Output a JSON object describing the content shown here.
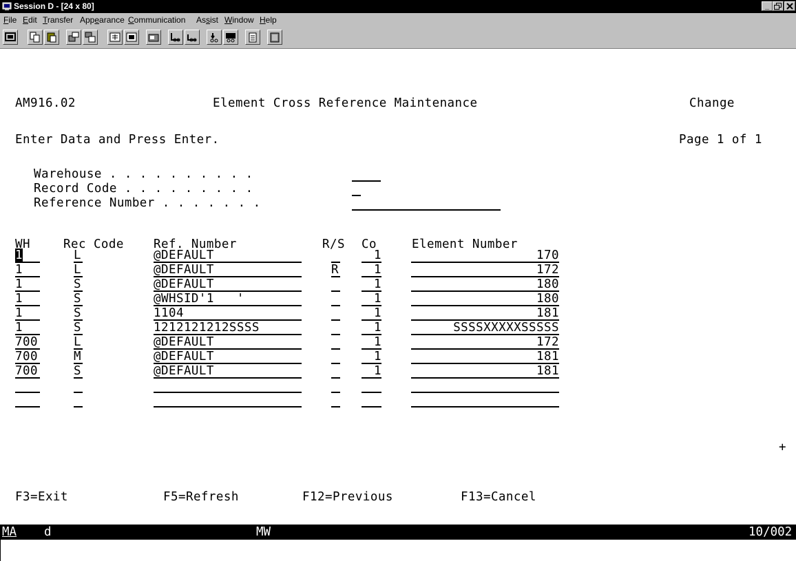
{
  "window": {
    "title": "Session D - [24 x 80]"
  },
  "menu": [
    {
      "label": "File",
      "u": "F",
      "rest": "ile"
    },
    {
      "label": "Edit",
      "u": "E",
      "rest": "dit"
    },
    {
      "label": "Transfer",
      "u": "T",
      "rest": "ransfer"
    },
    {
      "label": "Appearance",
      "pre": "App",
      "u": "e",
      "rest": "arance"
    },
    {
      "label": "Communication",
      "u": "C",
      "rest": "ommunication"
    },
    {
      "label": "Assist",
      "pre": "As",
      "u": "s",
      "rest": "ist"
    },
    {
      "label": "Window",
      "u": "W",
      "rest": "indow"
    },
    {
      "label": "Help",
      "u": "H",
      "rest": "elp"
    }
  ],
  "screen": {
    "program_id": "AM916.02",
    "title": "Element Cross Reference Maintenance",
    "mode": "Change",
    "instruction": "Enter Data and Press Enter.",
    "page": "Page 1 of 1",
    "filters": {
      "warehouse_label": "Warehouse . . . . . . . . . .",
      "record_code_label": "Record Code . . . . . . . . .",
      "reference_number_label": "Reference Number . . . . . . .",
      "warehouse_value": "",
      "record_code_value": "",
      "reference_number_value": ""
    },
    "headers": {
      "wh": "WH",
      "rec_code": "Rec Code",
      "ref_number": "Ref. Number",
      "rs": "R/S",
      "co": "Co",
      "element_number": "Element Number"
    },
    "rows": [
      {
        "wh": "1",
        "rec": "L",
        "ref": "@DEFAULT",
        "rs": "",
        "co": "1",
        "elem": "170"
      },
      {
        "wh": "1",
        "rec": "L",
        "ref": "@DEFAULT",
        "rs": "R",
        "co": "1",
        "elem": "172"
      },
      {
        "wh": "1",
        "rec": "S",
        "ref": "@DEFAULT",
        "rs": "",
        "co": "1",
        "elem": "180"
      },
      {
        "wh": "1",
        "rec": "S",
        "ref": "@WHSID'1   '",
        "rs": "",
        "co": "1",
        "elem": "180"
      },
      {
        "wh": "1",
        "rec": "S",
        "ref": "1104",
        "rs": "",
        "co": "1",
        "elem": "181"
      },
      {
        "wh": "1",
        "rec": "S",
        "ref": "1212121212SSSS",
        "rs": "",
        "co": "1",
        "elem": "SSSSXXXXXSSSSS"
      },
      {
        "wh": "700",
        "rec": "L",
        "ref": "@DEFAULT",
        "rs": "",
        "co": "1",
        "elem": "172"
      },
      {
        "wh": "700",
        "rec": "M",
        "ref": "@DEFAULT",
        "rs": "",
        "co": "1",
        "elem": "181"
      },
      {
        "wh": "700",
        "rec": "S",
        "ref": "@DEFAULT",
        "rs": "",
        "co": "1",
        "elem": "181"
      },
      {
        "wh": "",
        "rec": "",
        "ref": "",
        "rs": "",
        "co": "",
        "elem": ""
      },
      {
        "wh": "",
        "rec": "",
        "ref": "",
        "rs": "",
        "co": "",
        "elem": ""
      }
    ],
    "more_indicator": "+",
    "function_keys": {
      "f3": "F3=Exit",
      "f5": "F5=Refresh",
      "f12": "F12=Previous",
      "f13": "F13=Cancel"
    }
  },
  "status": {
    "indicator": "MA",
    "field1": "d",
    "field2": "MW",
    "position": "10/002"
  }
}
